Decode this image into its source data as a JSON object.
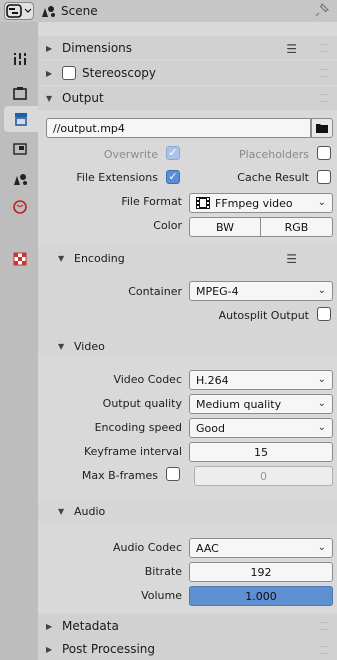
{
  "header": {
    "title": "Scene",
    "editor_icon": "properties-editor-icon",
    "pin_icon": "pin-icon"
  },
  "tabs": [
    {
      "name": "tool-tab",
      "icon": "tool-icon"
    },
    {
      "name": "render-tab",
      "icon": "render-icon"
    },
    {
      "name": "output-tab",
      "icon": "output-icon",
      "active": true
    },
    {
      "name": "view-layer-tab",
      "icon": "view-layer-icon"
    },
    {
      "name": "scene-tab",
      "icon": "scene-icon"
    },
    {
      "name": "world-tab",
      "icon": "world-icon"
    },
    {
      "name": "texture-tab",
      "icon": "texture-icon"
    }
  ],
  "panels": {
    "dimensions": "Dimensions",
    "stereoscopy": "Stereoscopy",
    "output": "Output",
    "metadata": "Metadata",
    "post_processing": "Post Processing"
  },
  "output": {
    "path": "//output.mp4",
    "overwrite_label": "Overwrite",
    "placeholders_label": "Placeholders",
    "file_extensions_label": "File Extensions",
    "cache_result_label": "Cache Result",
    "file_format_label": "File Format",
    "file_format_value": "FFmpeg video",
    "color_label": "Color",
    "color_options": [
      "BW",
      "RGB"
    ]
  },
  "encoding": {
    "title": "Encoding",
    "container_label": "Container",
    "container_value": "MPEG-4",
    "autosplit_label": "Autosplit Output"
  },
  "video": {
    "title": "Video",
    "codec_label": "Video Codec",
    "codec_value": "H.264",
    "quality_label": "Output quality",
    "quality_value": "Medium quality",
    "speed_label": "Encoding speed",
    "speed_value": "Good",
    "keyframe_label": "Keyframe interval",
    "keyframe_value": "15",
    "bframes_label": "Max B-frames",
    "bframes_value": "0"
  },
  "audio": {
    "title": "Audio",
    "codec_label": "Audio Codec",
    "codec_value": "AAC",
    "bitrate_label": "Bitrate",
    "bitrate_value": "192",
    "volume_label": "Volume",
    "volume_value": "1.000"
  }
}
